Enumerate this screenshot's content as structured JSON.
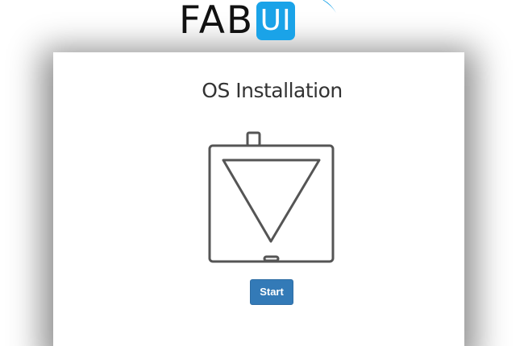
{
  "logo": {
    "text_main": "FAB",
    "text_badge": "UI",
    "brand_color": "#1aa3e8"
  },
  "page": {
    "title": "OS Installation"
  },
  "illustration": {
    "icon": "printer-icon"
  },
  "actions": {
    "start_label": "Start",
    "start_color": "#337ab7"
  }
}
